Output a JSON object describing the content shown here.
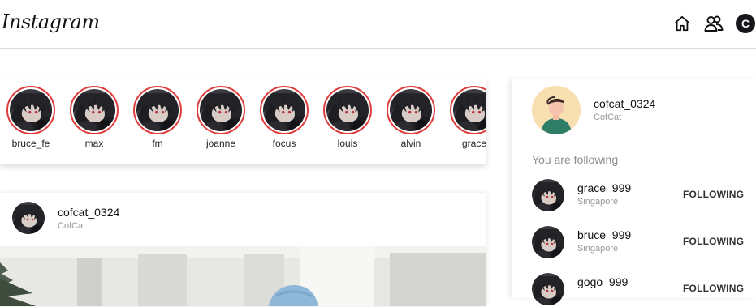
{
  "header": {
    "logo": "Instagram",
    "avatar_letter": "C"
  },
  "stories": [
    {
      "name": "bruce_fe"
    },
    {
      "name": "max"
    },
    {
      "name": "fm"
    },
    {
      "name": "joanne"
    },
    {
      "name": "focus"
    },
    {
      "name": "louis"
    },
    {
      "name": "alvin"
    },
    {
      "name": "grace"
    }
  ],
  "post": {
    "username": "cofcat_0324",
    "subtitle": "CofCat"
  },
  "sidebar": {
    "username": "cofcat_0324",
    "subtitle": "CofCat",
    "following_title": "You are following",
    "following": [
      {
        "name": "grace_999",
        "location": "Singapore",
        "action": "FOLLOWING"
      },
      {
        "name": "bruce_999",
        "location": "Singapore",
        "action": "FOLLOWING"
      },
      {
        "name": "gogo_999",
        "location": "",
        "action": "FOLLOWING"
      }
    ]
  },
  "colors": {
    "story_ring": "#e03c3c",
    "avatar_bg": "#16161d",
    "muted_text": "#999999"
  }
}
